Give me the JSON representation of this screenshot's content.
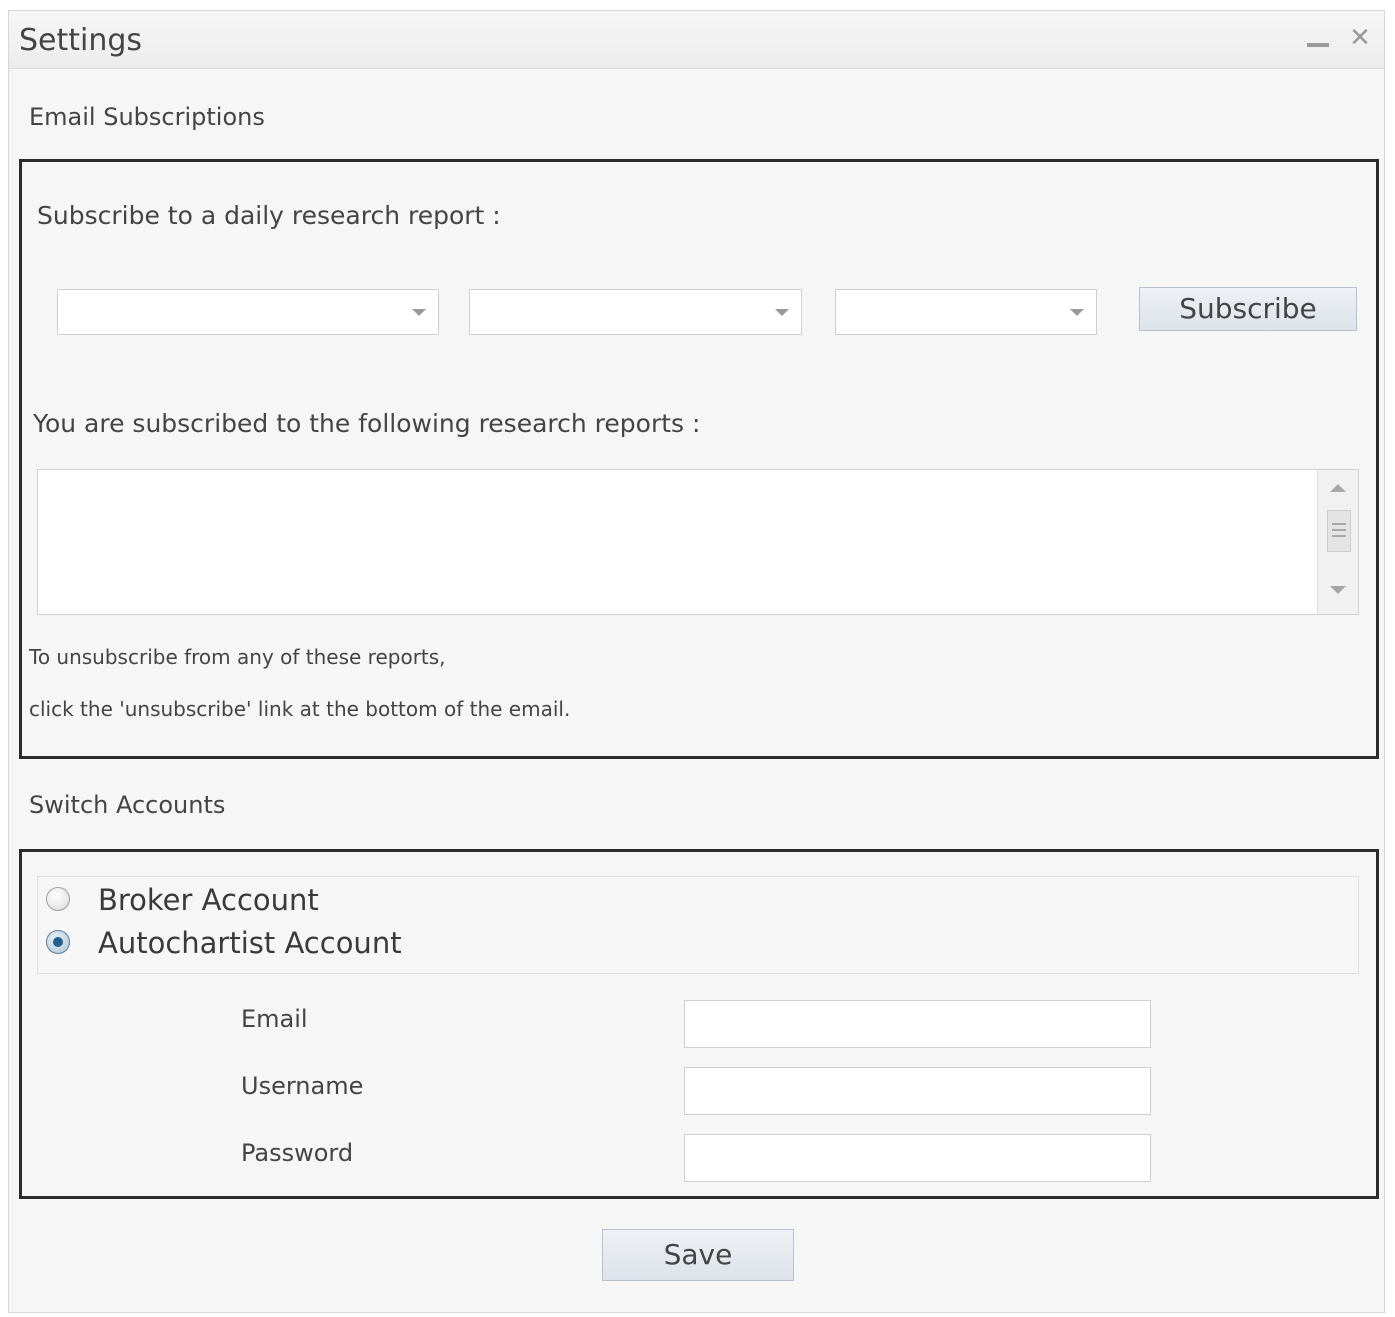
{
  "window": {
    "title": "Settings"
  },
  "email_subscriptions": {
    "section_label": "Email Subscriptions",
    "subscribe_prompt": "Subscribe to a daily research report :",
    "subscribe_button": "Subscribe",
    "subscribed_label": "You are subscribed to the following research reports :",
    "unsubscribe_note_1": "To unsubscribe from any of these reports,",
    "unsubscribe_note_2": "click the 'unsubscribe' link at the bottom of the email."
  },
  "switch_accounts": {
    "section_label": "Switch Accounts",
    "options": [
      {
        "label": "Broker Account",
        "checked": false
      },
      {
        "label": "Autochartist Account",
        "checked": true
      }
    ],
    "fields": {
      "email_label": "Email",
      "username_label": "Username",
      "password_label": "Password"
    }
  },
  "footer": {
    "save_button": "Save"
  },
  "icons": {
    "minimize": "minimize-icon",
    "close": "close-icon",
    "dropdown": "chevron-down-icon",
    "scroll_up": "scroll-up-icon",
    "scroll_down": "scroll-down-icon"
  },
  "colors": {
    "panel_border": "#2b2b2b",
    "window_bg": "#f6f6f6",
    "button_bg": "#dde3ea",
    "radio_selected": "#1f5f91"
  }
}
